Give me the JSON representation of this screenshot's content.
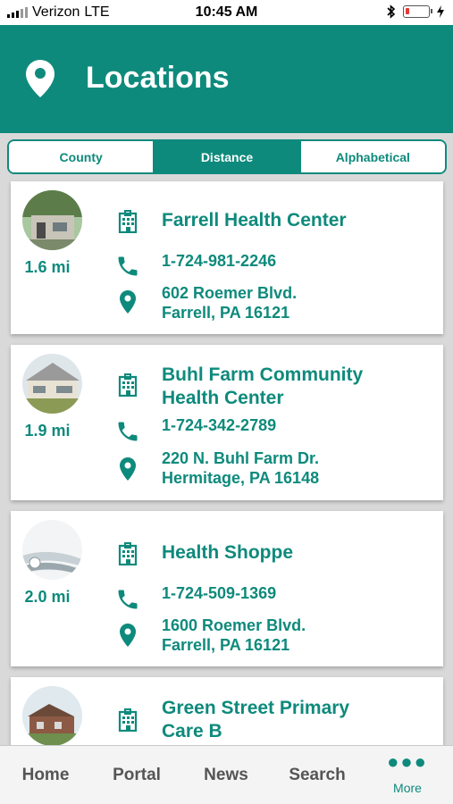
{
  "status_bar": {
    "carrier": "Verizon",
    "network": "LTE",
    "time": "10:45 AM",
    "battery_percent": 15
  },
  "colors": {
    "brand": "#0e8a7c",
    "header_bg": "#0e8a7c",
    "battery_low": "#e53935",
    "tab_text": "#555555"
  },
  "header": {
    "title": "Locations",
    "icon": "location-pin-icon"
  },
  "sort_tabs": [
    {
      "label": "County",
      "selected": false
    },
    {
      "label": "Distance",
      "selected": true
    },
    {
      "label": "Alphabetical",
      "selected": false
    }
  ],
  "locations": [
    {
      "distance": "1.6 mi",
      "name_lines": [
        "Farrell Health Center"
      ],
      "phone": "1-724-981-2246",
      "address_lines": [
        "602 Roemer Blvd.",
        "Farrell, PA 16121"
      ],
      "photo": "building-photo"
    },
    {
      "distance": "1.9 mi",
      "name_lines": [
        "Buhl Farm Community",
        "Health Center"
      ],
      "phone": "1-724-342-2789",
      "address_lines": [
        "220 N. Buhl Farm Dr.",
        "Hermitage, PA 16148"
      ],
      "photo": "building-photo"
    },
    {
      "distance": "2.0 mi",
      "name_lines": [
        "Health Shoppe"
      ],
      "phone": "1-724-509-1369",
      "address_lines": [
        "1600 Roemer Blvd.",
        "Farrell, PA 16121"
      ],
      "photo": "product-photo"
    },
    {
      "distance": "",
      "name_lines": [
        "Green Street Primary",
        "Care B"
      ],
      "phone": "",
      "address_lines": [],
      "photo": "building-photo"
    }
  ],
  "tab_bar": [
    {
      "label": "Home"
    },
    {
      "label": "Portal"
    },
    {
      "label": "News"
    },
    {
      "label": "Search"
    },
    {
      "label": "More",
      "icon": "more-dots-icon"
    }
  ]
}
